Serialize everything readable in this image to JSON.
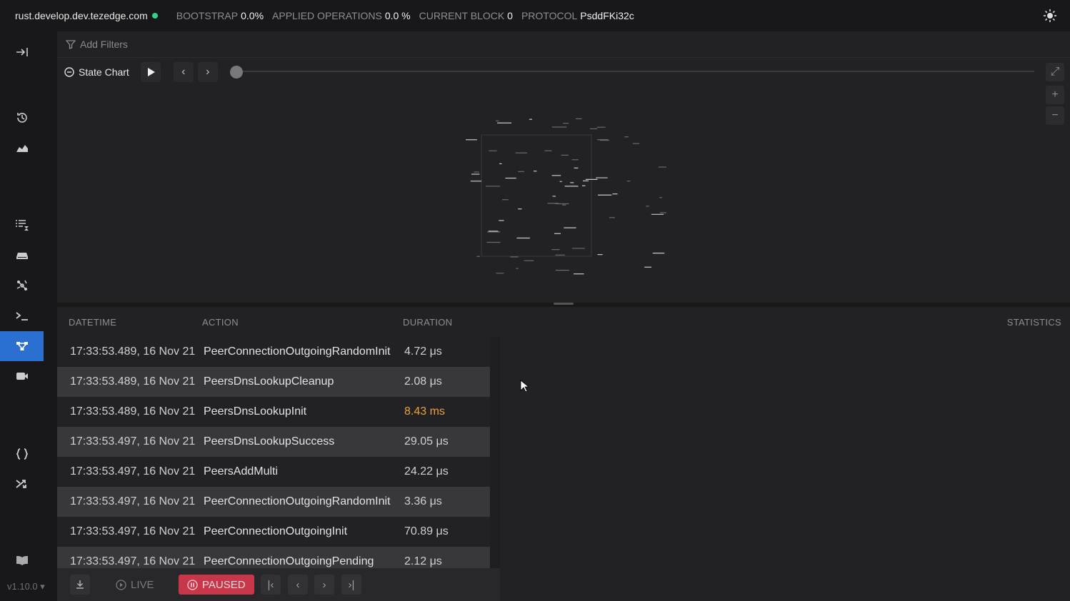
{
  "topbar": {
    "node": "rust.develop.dev.tezedge.com",
    "bootstrap_label": "BOOTSTRAP",
    "bootstrap_value": "0.0%",
    "applied_label": "APPLIED OPERATIONS",
    "applied_value": "0.0 %",
    "block_label": "CURRENT BLOCK",
    "block_value": "0",
    "protocol_label": "PROTOCOL",
    "protocol_value": "PsddFKi32c",
    "status_color": "#2fd38a"
  },
  "sidebar": {
    "items": [
      {
        "icon": "collapse-sidebar-icon"
      },
      {
        "icon": "history-icon"
      },
      {
        "icon": "area-chart-icon"
      },
      {
        "icon": "list-timer-icon"
      },
      {
        "icon": "storage-icon"
      },
      {
        "icon": "network-icon"
      },
      {
        "icon": "terminal-icon"
      },
      {
        "icon": "state-machine-icon",
        "active": true
      },
      {
        "icon": "video-icon"
      },
      {
        "icon": "braces-icon"
      },
      {
        "icon": "shuffle-icon"
      },
      {
        "icon": "book-icon"
      }
    ],
    "version": "v1.10.0"
  },
  "filters": {
    "add_label": "Add Filters"
  },
  "chart": {
    "title": "State Chart"
  },
  "table": {
    "columns": [
      "DATETIME",
      "ACTION",
      "DURATION"
    ],
    "statistics_label": "STATISTICS",
    "rows": [
      {
        "datetime": "17:33:53.489, 16 Nov 21",
        "action": "PeerConnectionOutgoingRandomInit",
        "duration": "4.72 μs",
        "warn": false
      },
      {
        "datetime": "17:33:53.489, 16 Nov 21",
        "action": "PeersDnsLookupCleanup",
        "duration": "2.08 μs",
        "warn": false
      },
      {
        "datetime": "17:33:53.489, 16 Nov 21",
        "action": "PeersDnsLookupInit",
        "duration": "8.43 ms",
        "warn": true
      },
      {
        "datetime": "17:33:53.497, 16 Nov 21",
        "action": "PeersDnsLookupSuccess",
        "duration": "29.05 μs",
        "warn": false
      },
      {
        "datetime": "17:33:53.497, 16 Nov 21",
        "action": "PeersAddMulti",
        "duration": "24.22 μs",
        "warn": false
      },
      {
        "datetime": "17:33:53.497, 16 Nov 21",
        "action": "PeerConnectionOutgoingRandomInit",
        "duration": "3.36 μs",
        "warn": false
      },
      {
        "datetime": "17:33:53.497, 16 Nov 21",
        "action": "PeerConnectionOutgoingInit",
        "duration": "70.89 μs",
        "warn": false
      },
      {
        "datetime": "17:33:53.497, 16 Nov 21",
        "action": "PeerConnectionOutgoingPending",
        "duration": "2.12 μs",
        "warn": false
      }
    ]
  },
  "footer": {
    "live_label": "LIVE",
    "paused_label": "PAUSED"
  }
}
